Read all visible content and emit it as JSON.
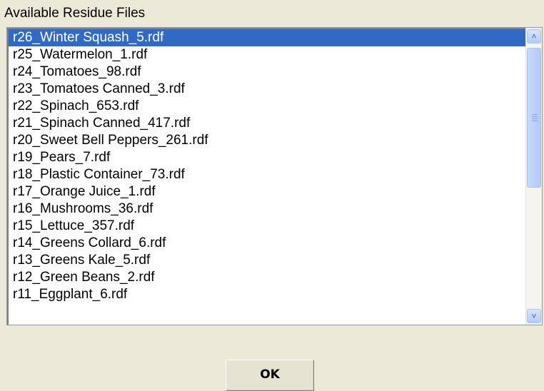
{
  "title": "Available Residue Files",
  "files": [
    {
      "label": "r26_Winter Squash_5.rdf",
      "selected": true
    },
    {
      "label": "r25_Watermelon_1.rdf"
    },
    {
      "label": "r24_Tomatoes_98.rdf"
    },
    {
      "label": "r23_Tomatoes  Canned_3.rdf"
    },
    {
      "label": "r22_Spinach_653.rdf"
    },
    {
      "label": "r21_Spinach  Canned_417.rdf"
    },
    {
      "label": "r20_Sweet Bell Peppers_261.rdf"
    },
    {
      "label": "r19_Pears_7.rdf"
    },
    {
      "label": "r18_Plastic Container_73.rdf"
    },
    {
      "label": "r17_Orange Juice_1.rdf"
    },
    {
      "label": "r16_Mushrooms_36.rdf"
    },
    {
      "label": "r15_Lettuce_357.rdf"
    },
    {
      "label": "r14_Greens  Collard_6.rdf"
    },
    {
      "label": "r13_Greens  Kale_5.rdf"
    },
    {
      "label": "r12_Green Beans_2.rdf"
    },
    {
      "label": "r11_Eggplant_6.rdf"
    }
  ],
  "scrollbar": {
    "up_icon": "chevron-up-icon",
    "down_icon": "chevron-down-icon"
  },
  "ok_label": "OK",
  "colors": {
    "selection": "#316ac5",
    "window_bg": "#ece9d8"
  }
}
